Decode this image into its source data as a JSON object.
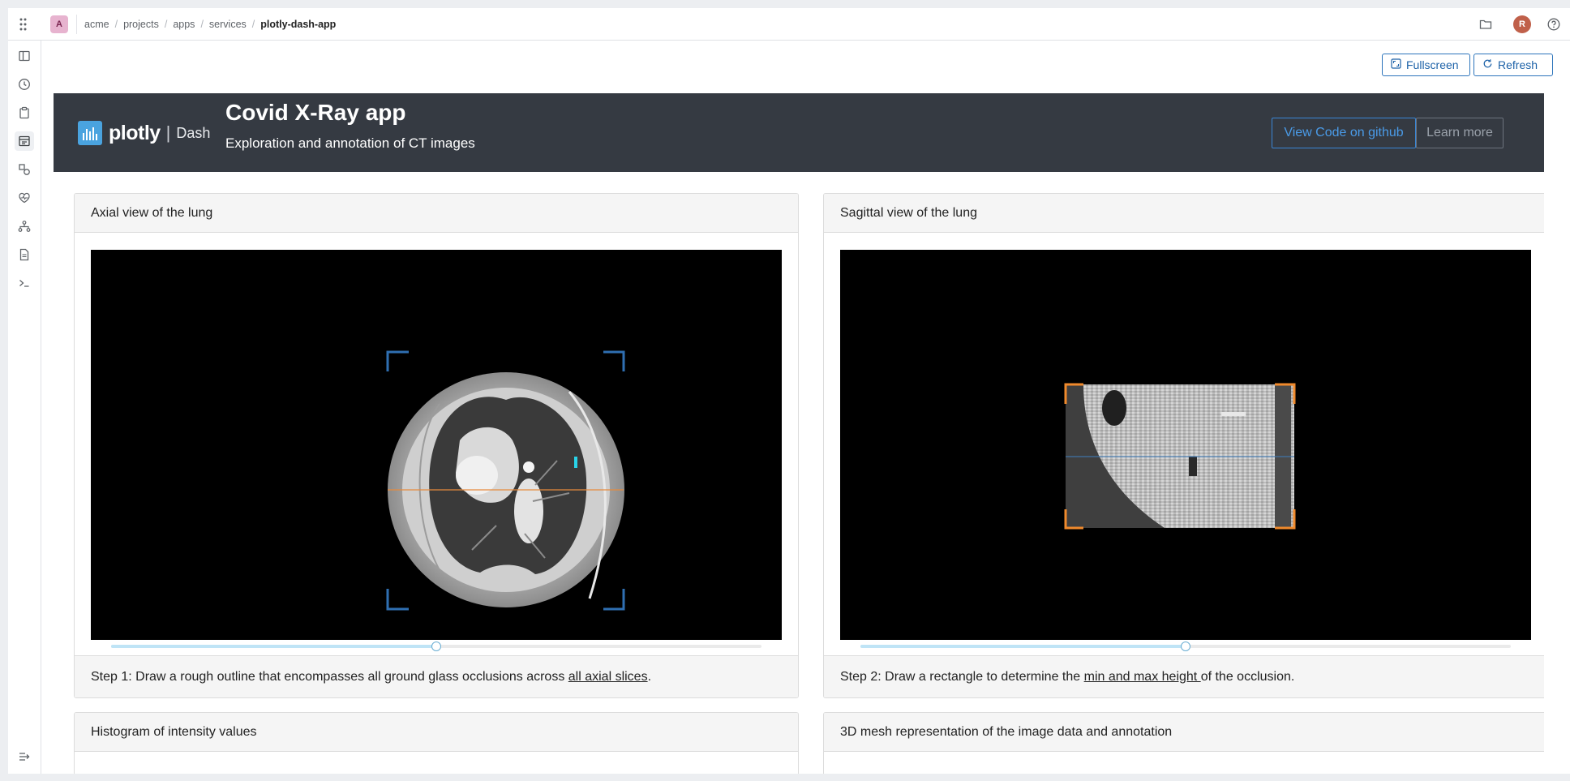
{
  "topbar": {
    "org_initial": "A",
    "breadcrumb": [
      "acme",
      "projects",
      "apps",
      "services"
    ],
    "breadcrumb_current": "plotly-dash-app",
    "user_initial": "R"
  },
  "actions": {
    "fullscreen_label": "Fullscreen",
    "refresh_label": "Refresh"
  },
  "banner": {
    "logo_text": "plotly",
    "logo_sep": "|",
    "logo_sub": "Dash",
    "title": "Covid X-Ray app",
    "subtitle": "Exploration and annotation of CT images",
    "github_label": "View Code on github",
    "learn_label": "Learn more"
  },
  "axial": {
    "header": "Axial view of the lung",
    "footer_pre": "Step 1: Draw a rough outline that encompasses all ground glass occlusions across ",
    "footer_link": "all axial slices",
    "footer_post": ".",
    "slider_fraction": 0.5
  },
  "sagittal": {
    "header": "Sagittal view of the lung",
    "footer_pre": "Step 2: Draw a rectangle to determine the ",
    "footer_link": "min and max height ",
    "footer_post": "of the occlusion.",
    "slider_fraction": 0.5
  },
  "histogram": {
    "header": "Histogram of intensity values"
  },
  "mesh": {
    "header": "3D mesh representation of the image data and annotation"
  },
  "colors": {
    "banner_bg": "#353a42",
    "accent_blue": "#2c74bb",
    "annotation_orange": "#f08a2c",
    "axial_crosshair": "#e68a3c",
    "sagittal_crosshair": "#3f7fbf"
  },
  "icons": {
    "rail": [
      "book-icon",
      "clock-icon",
      "clipboard-icon",
      "dashboard-icon",
      "shapes-icon",
      "heartbeat-icon",
      "hierarchy-icon",
      "document-icon",
      "terminal-icon"
    ],
    "collapse": "collapse-icon"
  }
}
